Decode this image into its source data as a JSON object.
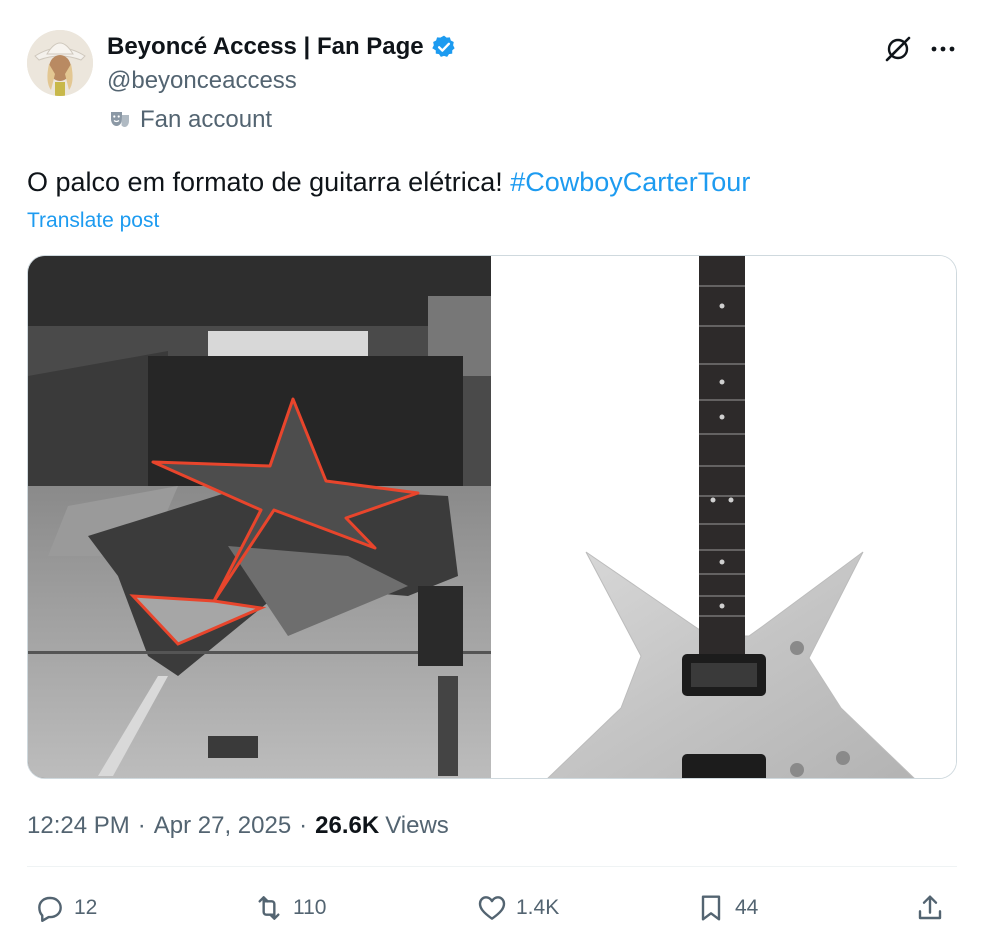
{
  "author": {
    "name": "Beyoncé Access | Fan Page",
    "handle": "@beyonceaccess",
    "affiliation": "Fan account",
    "verified_color": "#1d9bf0"
  },
  "post": {
    "text": "O palco em formato de guitarra elétrica! ",
    "hashtag": "#CowboyCarterTour",
    "translate_label": "Translate post"
  },
  "media": [
    {
      "description_icon": "stadium-stage-photo"
    },
    {
      "description_icon": "star-guitar-photo"
    }
  ],
  "meta": {
    "time": "12:24 PM",
    "dot": "·",
    "date": "Apr 27, 2025",
    "views_count": "26.6K",
    "views_label": "Views"
  },
  "actions": {
    "replies": "12",
    "reposts": "110",
    "likes": "1.4K",
    "bookmarks": "44"
  },
  "colors": {
    "accent": "#1d9bf0",
    "secondary_text": "#536471",
    "primary_text": "#0f1419",
    "stage_outline": "#e8452c"
  }
}
